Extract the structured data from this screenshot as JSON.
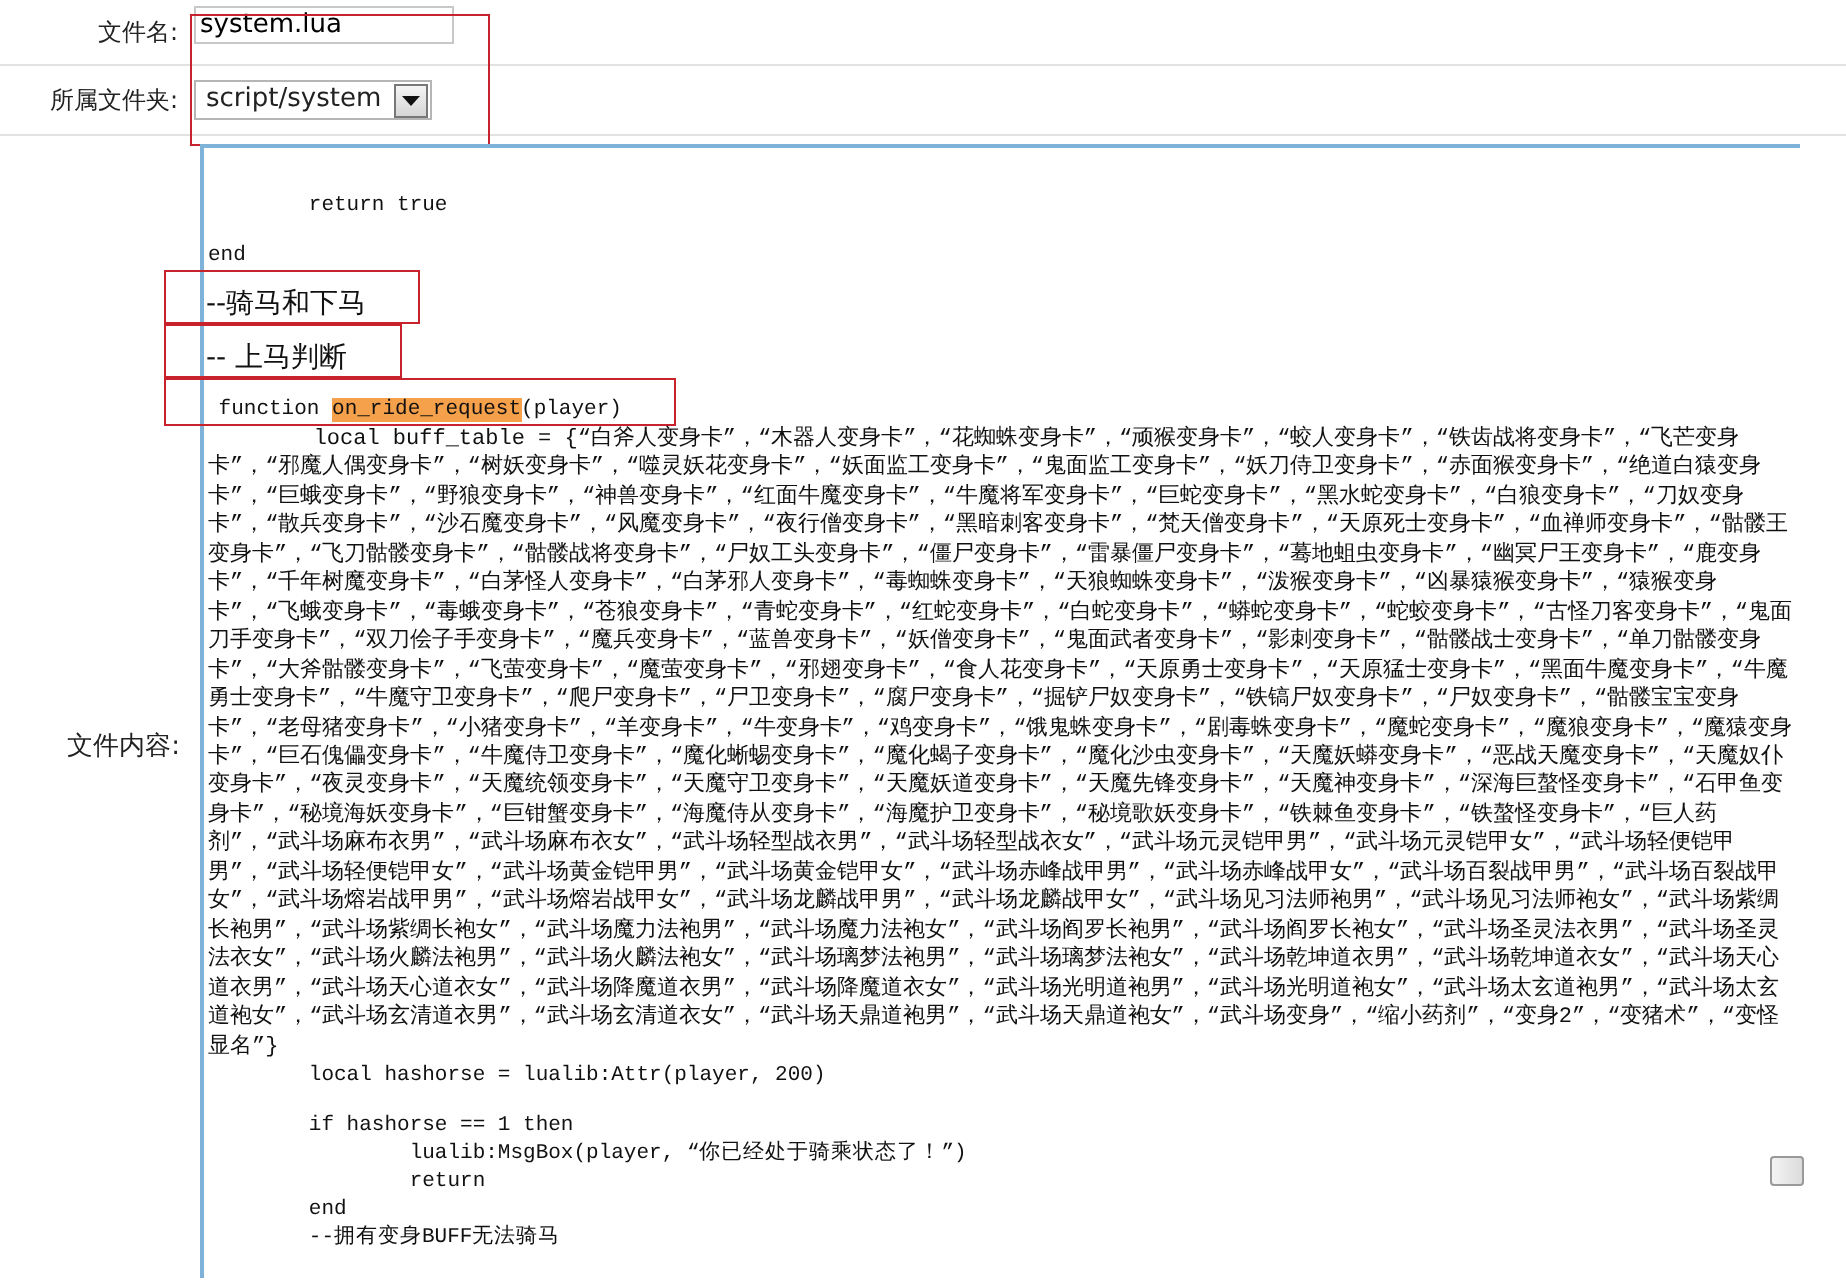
{
  "form": {
    "annotated": true,
    "fields": [
      {
        "label": "文件名:",
        "kind": "text",
        "value": "system.lua"
      },
      {
        "label": "所属文件夹:",
        "kind": "select",
        "value": "script/system"
      }
    ]
  },
  "content": {
    "label": "文件内容:",
    "lines": [
      {
        "kind": "blank"
      },
      {
        "kind": "blank"
      },
      {
        "kind": "code",
        "text": "        return true",
        "annotated": false
      },
      {
        "kind": "blank"
      },
      {
        "kind": "code",
        "text": "end",
        "annotated": false
      },
      {
        "kind": "comment",
        "text": "--骑马和下马",
        "annotated": true
      },
      {
        "kind": "comment",
        "text": "-- 上马判断",
        "annotated": true
      },
      {
        "kind": "code",
        "text": " function ",
        "highlight": "on_ride_request",
        "after": "(player)",
        "annotated": true
      },
      {
        "kind": "wrap",
        "text": "        local buff_table = {“白斧人变身卡”，“木器人变身卡”，“花蜘蛛变身卡”，“顽猴变身卡”，“蛟人变身卡”，“铁齿战将变身卡”，“飞芒变身卡”，“邪魔人偶变身卡”，“树妖变身卡”，“噬灵妖花变身卡”，“妖面监工变身卡”，“鬼面监工变身卡”，“妖刀侍卫变身卡”，“赤面猴变身卡”，“绝道白猿变身卡”，“巨蛾变身卡”，“野狼变身卡”，“神兽变身卡”，“红面牛魔变身卡”，“牛魔将军变身卡”，“巨蛇变身卡”，“黑水蛇变身卡”，“白狼变身卡”，“刀奴变身卡”，“散兵变身卡”，“沙石魔变身卡”，“风魔变身卡”，“夜行僧变身卡”，“黑暗刺客变身卡”，“梵天僧变身卡”，“天原死士变身卡”，“血禅师变身卡”，“骷髅王变身卡”，“飞刀骷髅变身卡”，“骷髅战将变身卡”，“尸奴工头变身卡”，“僵尸变身卡”，“雷暴僵尸变身卡”，“蓦地蛆虫变身卡”，“幽冥尸王变身卡”，“鹿变身卡”，“千年树魔变身卡”，“白茅怪人变身卡”，“白茅邪人变身卡”，“毒蜘蛛变身卡”，“天狼蜘蛛变身卡”，“泼猴变身卡”，“凶暴猿猴变身卡”，“猿猴变身卡”，“飞蛾变身卡”，“毒蛾变身卡”，“苍狼变身卡”，“青蛇变身卡”，“红蛇变身卡”，“白蛇变身卡”，“蟒蛇变身卡”，“蛇蛟变身卡”，“古怪刀客变身卡”，“鬼面刀手变身卡”，“双刀侩子手变身卡”，“魔兵变身卡”，“蓝兽变身卡”，“妖僧变身卡”，“鬼面武者变身卡”，“影刺变身卡”，“骷髅战士变身卡”，“单刀骷髅变身卡”，“大斧骷髅变身卡”，“飞萤变身卡”，“魔萤变身卡”，“邪翅变身卡”，“食人花变身卡”，“天原勇士变身卡”，“天原猛士变身卡”，“黑面牛魔变身卡”，“牛魔勇士变身卡”，“牛魔守卫变身卡”，“爬尸变身卡”，“尸卫变身卡”，“腐尸变身卡”，“掘铲尸奴变身卡”，“铁镐尸奴变身卡”，“尸奴变身卡”，“骷髅宝宝变身卡”，“老母猪变身卡”，“小猪变身卡”，“羊变身卡”，“牛变身卡”，“鸡变身卡”，“饿鬼蛛变身卡”，“剧毒蛛变身卡”，“魔蛇变身卡”，“魔狼变身卡”，“魔猿变身卡”，“巨石傀儡变身卡”，“牛魔侍卫变身卡”，“魔化蜥蜴变身卡”，“魔化蝎子变身卡”，“魔化沙虫变身卡”，“天魔妖蟒变身卡”，“恶战天魔变身卡”，“天魔奴仆变身卡”，“夜灵变身卡”，“天魔统领变身卡”，“天魔守卫变身卡”，“天魔妖道变身卡”，“天魔先锋变身卡”，“天魔神变身卡”，“深海巨螯怪变身卡”，“石甲鱼变身卡”，“秘境海妖变身卡”，“巨钳蟹变身卡”，“海魔侍从变身卡”，“海魔护卫变身卡”，“秘境歌妖变身卡”，“铁棘鱼变身卡”，“铁螯怪变身卡”，“巨人药剂”，“武斗场麻布衣男”，“武斗场麻布衣女”，“武斗场轻型战衣男”，“武斗场轻型战衣女”，“武斗场元灵铠甲男”，“武斗场元灵铠甲女”，“武斗场轻便铠甲男”，“武斗场轻便铠甲女”，“武斗场黄金铠甲男”，“武斗场黄金铠甲女”，“武斗场赤峰战甲男”，“武斗场赤峰战甲女”，“武斗场百裂战甲男”，“武斗场百裂战甲女”，“武斗场熔岩战甲男”，“武斗场熔岩战甲女”，“武斗场龙麟战甲男”，“武斗场龙麟战甲女”，“武斗场见习法师袍男”，“武斗场见习法师袍女”，“武斗场紫绸长袍男”，“武斗场紫绸长袍女”，“武斗场魔力法袍男”，“武斗场魔力法袍女”，“武斗场阎罗长袍男”，“武斗场阎罗长袍女”，“武斗场圣灵法衣男”，“武斗场圣灵法衣女”，“武斗场火麟法袍男”，“武斗场火麟法袍女”，“武斗场璃梦法袍男”，“武斗场璃梦法袍女”，“武斗场乾坤道衣男”，“武斗场乾坤道衣女”，“武斗场天心道衣男”，“武斗场天心道衣女”，“武斗场降魔道衣男”，“武斗场降魔道衣女”，“武斗场光明道袍男”，“武斗场光明道袍女”，“武斗场太玄道袍男”，“武斗场太玄道袍女”，“武斗场玄清道衣男”，“武斗场玄清道衣女”，“武斗场天鼎道袍男”，“武斗场天鼎道袍女”，“武斗场变身”，“缩小药剂”，“变身2”，“变猪术”，“变怪显名”}",
        "annotated": false
      },
      {
        "kind": "code",
        "text": "        local hashorse = lualib:Attr(player, 200)",
        "annotated": false
      },
      {
        "kind": "blank"
      },
      {
        "kind": "code",
        "text": "        if hashorse == 1 then",
        "annotated": false
      },
      {
        "kind": "code",
        "text": "                lualib:MsgBox(player, “你已经处于骑乘状态了！”)",
        "annotated": false
      },
      {
        "kind": "code",
        "text": "                return",
        "annotated": false
      },
      {
        "kind": "code",
        "text": "        end",
        "annotated": false
      },
      {
        "kind": "code",
        "text": "        --拥有变身BUFF无法骑马",
        "annotated": false
      }
    ]
  }
}
